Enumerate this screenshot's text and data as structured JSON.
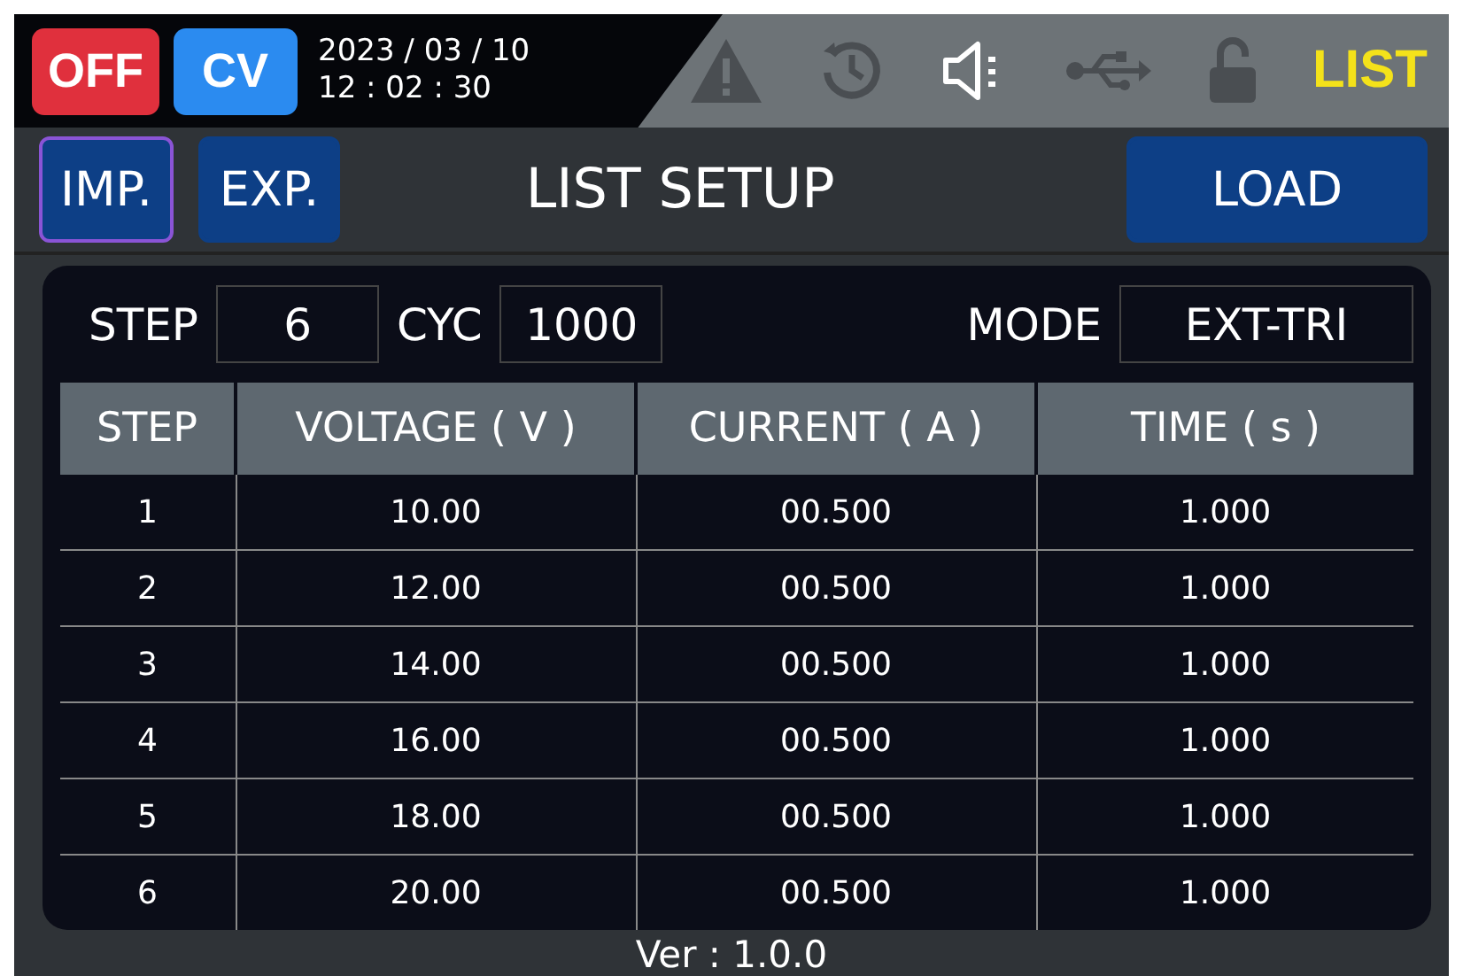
{
  "status_bar": {
    "output": "OFF",
    "mode": "CV",
    "date": "2023 / 03 / 10",
    "time": "12 : 02 : 30",
    "function": "LIST"
  },
  "toolbar": {
    "buttons": [
      {
        "label": "IMP.",
        "selected": true
      },
      {
        "label": "EXP.",
        "selected": false
      }
    ],
    "title": "LIST  SETUP",
    "load_button": "LOAD"
  },
  "params": {
    "step_label": "STEP",
    "step": "6",
    "cyc_label": "CYC",
    "cyc": "1000",
    "mode_label": "MODE",
    "mode": "EXT-TRI"
  },
  "table": {
    "columns": [
      "STEP",
      "VOLTAGE ( V )",
      "CURRENT ( A )",
      "TIME ( s )"
    ],
    "rows": [
      [
        "1",
        "10.00",
        "00.500",
        "1.000"
      ],
      [
        "2",
        "12.00",
        "00.500",
        "1.000"
      ],
      [
        "3",
        "14.00",
        "00.500",
        "1.000"
      ],
      [
        "4",
        "16.00",
        "00.500",
        "1.000"
      ],
      [
        "5",
        "18.00",
        "00.500",
        "1.000"
      ],
      [
        "6",
        "20.00",
        "00.500",
        "1.000"
      ]
    ]
  },
  "version": "Ver :  1.0.0"
}
